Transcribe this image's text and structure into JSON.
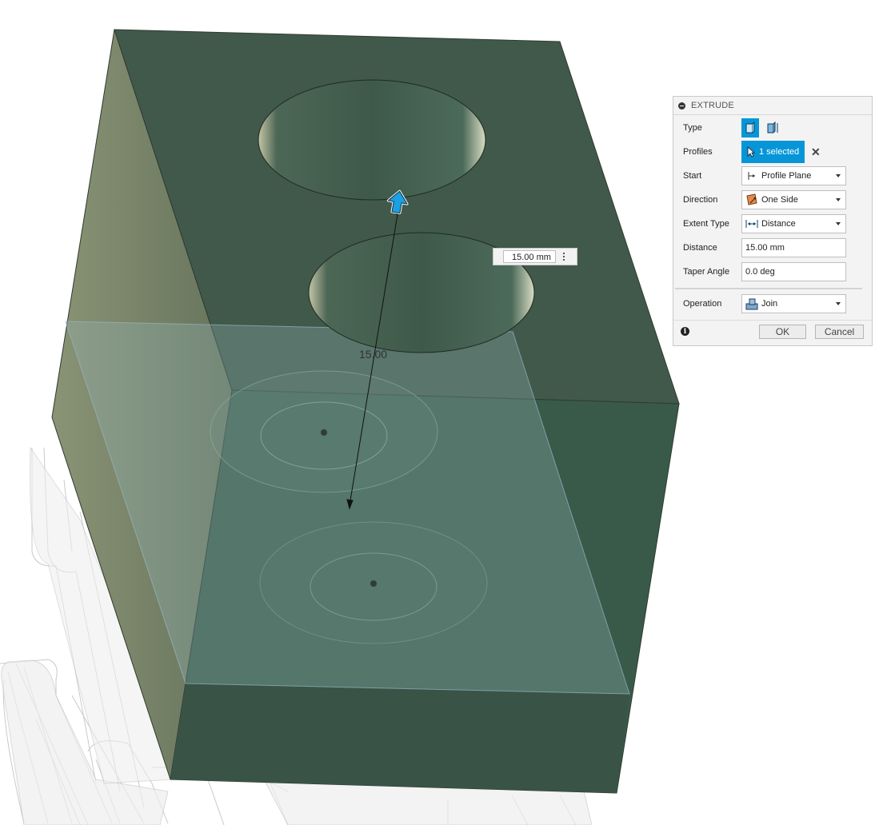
{
  "canvas": {
    "dimension_label": "15.00",
    "distance_input_value": "15.00 mm"
  },
  "panel": {
    "title": "EXTRUDE",
    "rows": {
      "type": {
        "label": "Type"
      },
      "profiles": {
        "label": "Profiles",
        "value": "1 selected"
      },
      "start": {
        "label": "Start",
        "value": "Profile Plane"
      },
      "direction": {
        "label": "Direction",
        "value": "One Side"
      },
      "extent_type": {
        "label": "Extent Type",
        "value": "Distance"
      },
      "distance": {
        "label": "Distance",
        "value": "15.00 mm"
      },
      "taper_angle": {
        "label": "Taper Angle",
        "value": "0.0 deg"
      },
      "operation": {
        "label": "Operation",
        "value": "Join"
      }
    },
    "ok_label": "OK",
    "cancel_label": "Cancel"
  },
  "icons": {
    "collapse": "collapse-icon",
    "type_solid": "extrude-solid-icon",
    "type_thin": "extrude-thin-icon",
    "profile_cursor": "cursor-arrow-icon",
    "clear": "close-icon",
    "start": "profile-plane-icon",
    "direction": "one-side-direction-icon",
    "extent": "distance-extent-icon",
    "operation": "join-operation-icon",
    "info": "info-icon",
    "manipulator": "extrude-arrow-manipulator-icon"
  },
  "colors": {
    "body": "#3f5a4c",
    "preview": "#3a5f5c",
    "accent": "#0696d7"
  }
}
